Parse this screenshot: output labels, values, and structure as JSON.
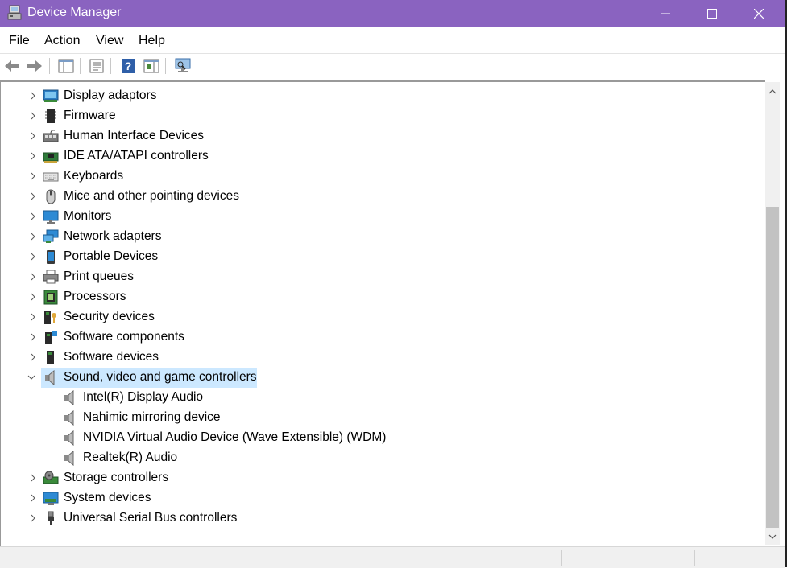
{
  "window": {
    "title": "Device Manager",
    "titlebar_color": "#8a63c0",
    "controls": [
      "minimize-icon",
      "maximize-icon",
      "close-icon"
    ]
  },
  "menu": {
    "items": [
      "File",
      "Action",
      "View",
      "Help"
    ]
  },
  "toolbar": {
    "buttons": [
      "back-arrow-icon",
      "forward-arrow-icon",
      "show-hide-console-tree-icon",
      "properties-icon",
      "help-icon",
      "show-action-pane-icon",
      "scan-hardware-changes-icon"
    ]
  },
  "tree": {
    "selection_color": "#cce8ff",
    "nodes": [
      {
        "label": "Display adaptors",
        "icon": "display-adapter-icon",
        "expanded": false
      },
      {
        "label": "Firmware",
        "icon": "firmware-icon",
        "expanded": false
      },
      {
        "label": "Human Interface Devices",
        "icon": "hid-icon",
        "expanded": false
      },
      {
        "label": "IDE ATA/ATAPI controllers",
        "icon": "ide-controller-icon",
        "expanded": false
      },
      {
        "label": "Keyboards",
        "icon": "keyboard-icon",
        "expanded": false
      },
      {
        "label": "Mice and other pointing devices",
        "icon": "mouse-icon",
        "expanded": false
      },
      {
        "label": "Monitors",
        "icon": "monitor-icon",
        "expanded": false
      },
      {
        "label": "Network adapters",
        "icon": "network-adapter-icon",
        "expanded": false
      },
      {
        "label": "Portable Devices",
        "icon": "portable-device-icon",
        "expanded": false
      },
      {
        "label": "Print queues",
        "icon": "printer-icon",
        "expanded": false
      },
      {
        "label": "Processors",
        "icon": "processor-icon",
        "expanded": false
      },
      {
        "label": "Security devices",
        "icon": "security-device-icon",
        "expanded": false
      },
      {
        "label": "Software components",
        "icon": "software-component-icon",
        "expanded": false
      },
      {
        "label": "Software devices",
        "icon": "software-device-icon",
        "expanded": false
      },
      {
        "label": "Sound, video and game controllers",
        "icon": "speaker-icon",
        "expanded": true,
        "selected": true,
        "children": [
          {
            "label": "Intel(R) Display Audio",
            "icon": "speaker-icon"
          },
          {
            "label": "Nahimic mirroring device",
            "icon": "speaker-icon"
          },
          {
            "label": "NVIDIA Virtual Audio Device (Wave Extensible) (WDM)",
            "icon": "speaker-icon"
          },
          {
            "label": "Realtek(R) Audio",
            "icon": "speaker-icon"
          }
        ]
      },
      {
        "label": "Storage controllers",
        "icon": "storage-controller-icon",
        "expanded": false
      },
      {
        "label": "System devices",
        "icon": "system-device-icon",
        "expanded": false
      },
      {
        "label": "Universal Serial Bus controllers",
        "icon": "usb-icon",
        "expanded": false
      }
    ]
  },
  "scrollbar": {
    "position_fraction": 0.3
  }
}
